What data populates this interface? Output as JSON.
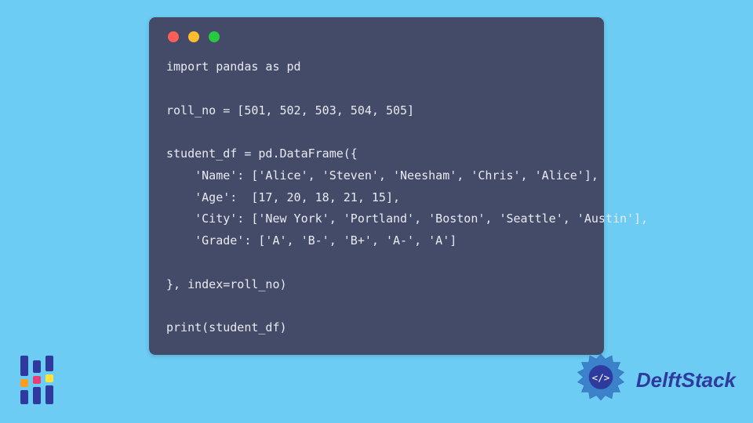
{
  "code": {
    "lines": [
      "import pandas as pd",
      "",
      "roll_no = [501, 502, 503, 504, 505]",
      "",
      "student_df = pd.DataFrame({",
      "    'Name': ['Alice', 'Steven', 'Neesham', 'Chris', 'Alice'],",
      "    'Age':  [17, 20, 18, 21, 15],",
      "    'City': ['New York', 'Portland', 'Boston', 'Seattle', 'Austin'],",
      "    'Grade': ['A', 'B-', 'B+', 'A-', 'A']",
      "",
      "}, index=roll_no)",
      "",
      "print(student_df)"
    ]
  },
  "brand": {
    "name": "DelftStack"
  },
  "colors": {
    "page_bg": "#6cccf4",
    "window_bg": "#444b69",
    "code_text": "#e9eaf0",
    "brand_blue": "#2f3a9e",
    "dot_red": "#ff5f57",
    "dot_yellow": "#ffbd2e",
    "dot_green": "#28c840"
  }
}
